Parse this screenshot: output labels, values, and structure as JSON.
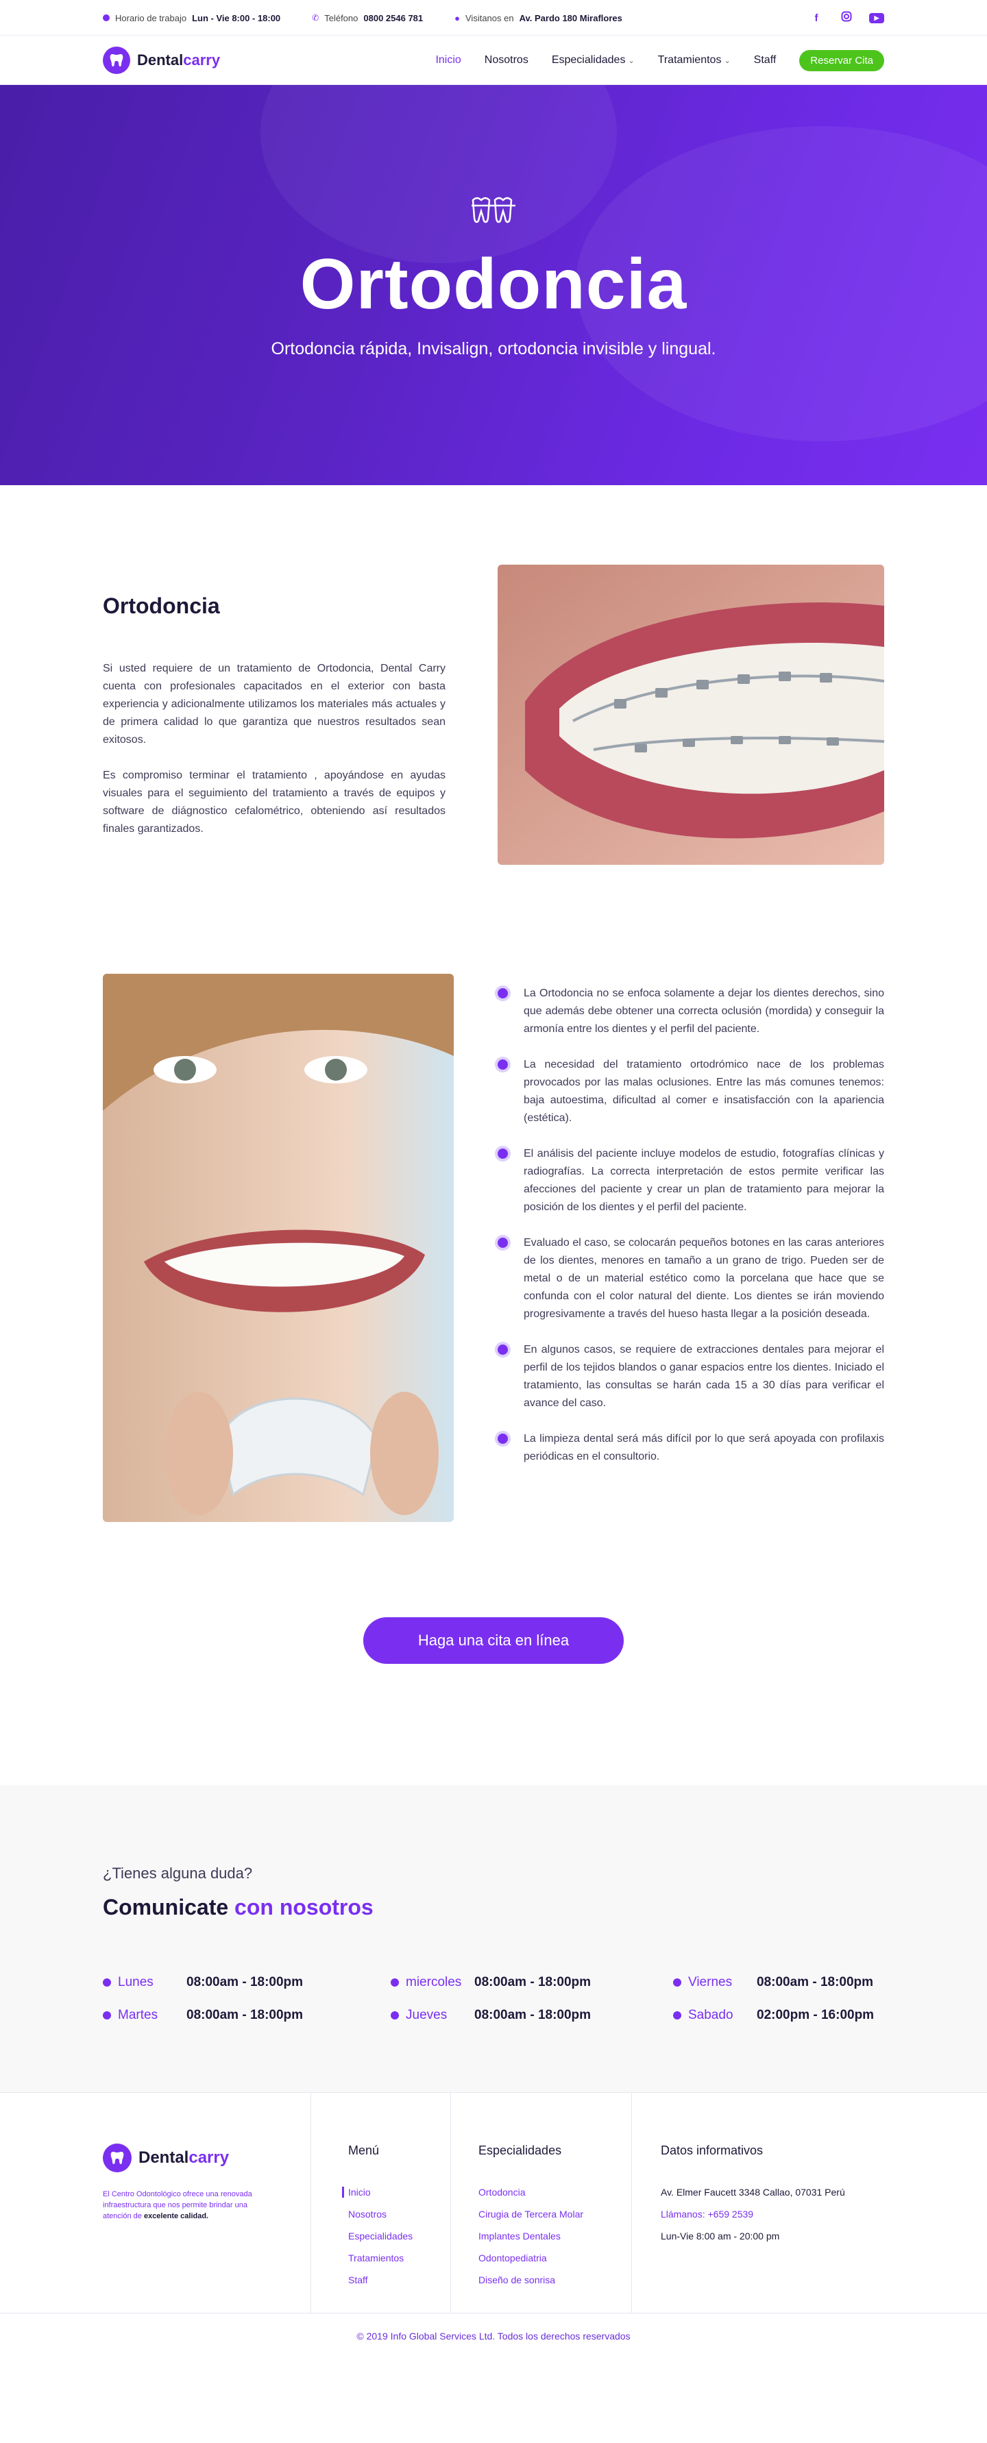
{
  "topbar": {
    "hours_label": "Horario de trabajo",
    "hours_value": "Lun - Vie 8:00 - 18:00",
    "phone_label": "Teléfono",
    "phone_value": "0800 2546 781",
    "address_label": "Visitanos en",
    "address_value": "Av. Pardo 180 Miraflores",
    "social_icons": [
      "facebook-icon",
      "instagram-icon",
      "youtube-icon"
    ]
  },
  "brand": {
    "name_a": "Dental",
    "name_b": "carry",
    "accent": "#7a2ff0",
    "cta_green": "#4cc41c"
  },
  "nav": {
    "items": [
      "Inicio",
      "Nosotros",
      "Especialidades",
      "Tratamientos",
      "Staff"
    ],
    "active": "Inicio",
    "cta": "Reservar Cita"
  },
  "hero": {
    "title": "Ortodoncia",
    "subtitle": "Ortodoncia rápida, Invisalign, ortodoncia invisible y lingual."
  },
  "intro": {
    "heading": "Ortodoncia",
    "paragraphs": [
      "Si usted requiere de un tratamiento de Ortodoncia, Dental Carry cuenta con profesionales capacitados en el exterior con basta experiencia y adicionalmente utilizamos los materiales más actuales y de primera calidad lo que garantiza que nuestros resultados sean exitosos.",
      "Es compromiso terminar el tratamiento , apoyándose en ayudas visuales para el seguimiento del tratamiento a través de equipos y software de diágnostico cefalométrico, obteniendo así resultados finales garantizados."
    ]
  },
  "details": {
    "bullets": [
      "La Ortodoncia no se enfoca solamente a dejar los dientes derechos, sino que además debe obtener una correcta oclusión (mordida) y conseguir la armonía entre los dientes y el perfil del paciente.",
      "La necesidad del tratamiento ortodrómico nace de los problemas provocados por las malas oclusiones. Entre las más comunes tenemos: baja autoestima, dificultad al comer e insatisfacción con la apariencia (estética).",
      "El análisis del paciente incluye modelos de estudio, fotografías clínicas y radiografías. La correcta interpretación de estos permite verificar las afecciones del paciente y crear un plan de tratamiento para mejorar la posición de los dientes y el perfil del paciente.",
      "Evaluado el caso, se colocarán pequeños botones en las caras anteriores de los dientes, menores en tamaño a un grano de trigo. Pueden ser de metal o de un material estético como la porcelana que hace que se confunda con el color natural del diente. Los dientes se irán moviendo progresivamente a través del hueso hasta llegar a la posición deseada.",
      "En algunos casos, se requiere de extracciones dentales para mejorar el perfil de los tejidos blandos o ganar espacios entre los dientes. Iniciado el tratamiento, las consultas se harán cada 15 a 30 días para verificar el avance del caso.",
      "La limpieza dental será más difícil por lo que será apoyada con profilaxis periódicas en el consultorio."
    ]
  },
  "cta": {
    "label": "Haga una cita en línea"
  },
  "contact": {
    "question": "¿Tienes alguna duda?",
    "title_a": "Comunicate",
    "title_b": "con nosotros",
    "hours": [
      {
        "day": "Lunes",
        "time": "08:00am - 18:00pm"
      },
      {
        "day": "miercoles",
        "time": "08:00am - 18:00pm"
      },
      {
        "day": "Viernes",
        "time": "08:00am - 18:00pm"
      },
      {
        "day": "Martes",
        "time": "08:00am - 18:00pm"
      },
      {
        "day": "Jueves",
        "time": "08:00am - 18:00pm"
      },
      {
        "day": "Sabado",
        "time": "02:00pm - 16:00pm"
      }
    ]
  },
  "footer": {
    "about_text": "El Centro Odontológico ofrece una renovada infraestructura que nos permite brindar una atención de",
    "about_bold": "excelente calidad.",
    "menu_title": "Menú",
    "menu": [
      "Inicio",
      "Nosotros",
      "Especialidades",
      "Tratamientos",
      "Staff"
    ],
    "spec_title": "Especialidades",
    "specialties": [
      "Ortodoncia",
      "Cirugia de Tercera Molar",
      "Implantes Dentales",
      "Odontopediatria",
      "Diseño de sonrisa"
    ],
    "info_title": "Datos informativos",
    "address": "Av. Elmer Faucett 3348 Callao, 07031 Perú",
    "phone": "Llámanos: +659 2539",
    "schedule": "Lun-Vie 8:00 am - 20:00 pm",
    "copyright": "© 2019 Info Global Services Ltd. Todos los derechos reservados"
  }
}
